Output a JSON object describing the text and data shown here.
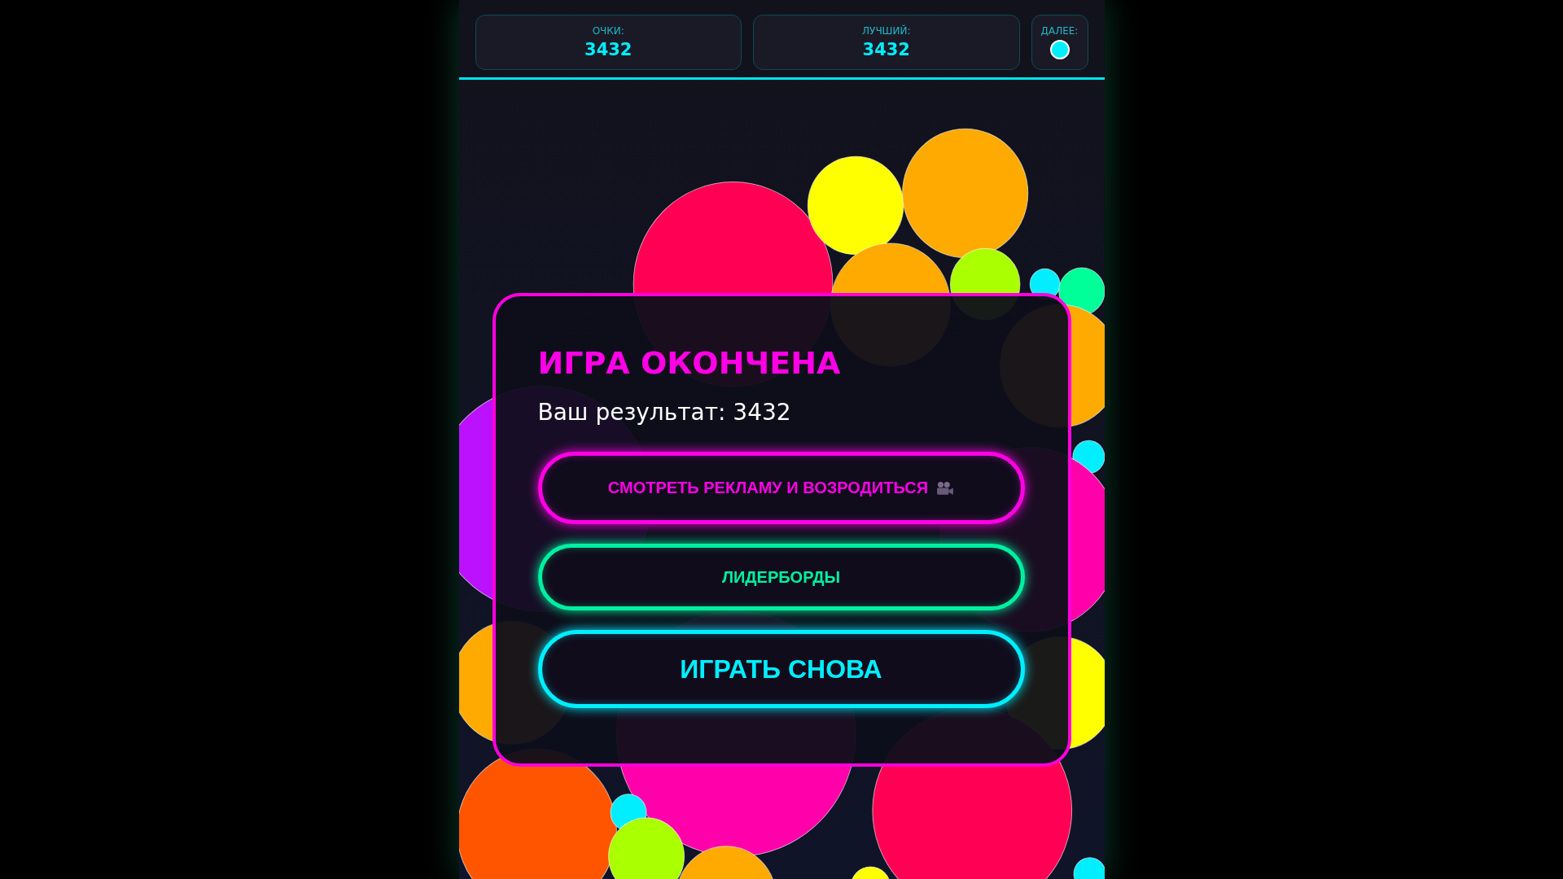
{
  "stats": [
    {
      "label": "ОЧКИ:",
      "value": "3432"
    },
    {
      "label": "ЛУЧШИЙ:",
      "value": "3432"
    }
  ],
  "next": {
    "label": "ДАЛЕЕ:",
    "color": "#00f0ff"
  },
  "dialog": {
    "title": "ИГРА ОКОНЧЕНА",
    "result": "Ваш результат: 3432",
    "buttons": [
      {
        "kind": "ad",
        "label": "СМОТРЕТЬ РЕКЛАМУ И ВОЗРОДИТЬСЯ",
        "color": "#ff00e6"
      },
      {
        "kind": "leaderboard",
        "label": "ЛИДЕРБОРДЫ",
        "color": "#00f0a0"
      },
      {
        "kind": "replay",
        "label": "ИГРАТЬ СНОВА",
        "color": "#00eeff"
      }
    ]
  }
}
